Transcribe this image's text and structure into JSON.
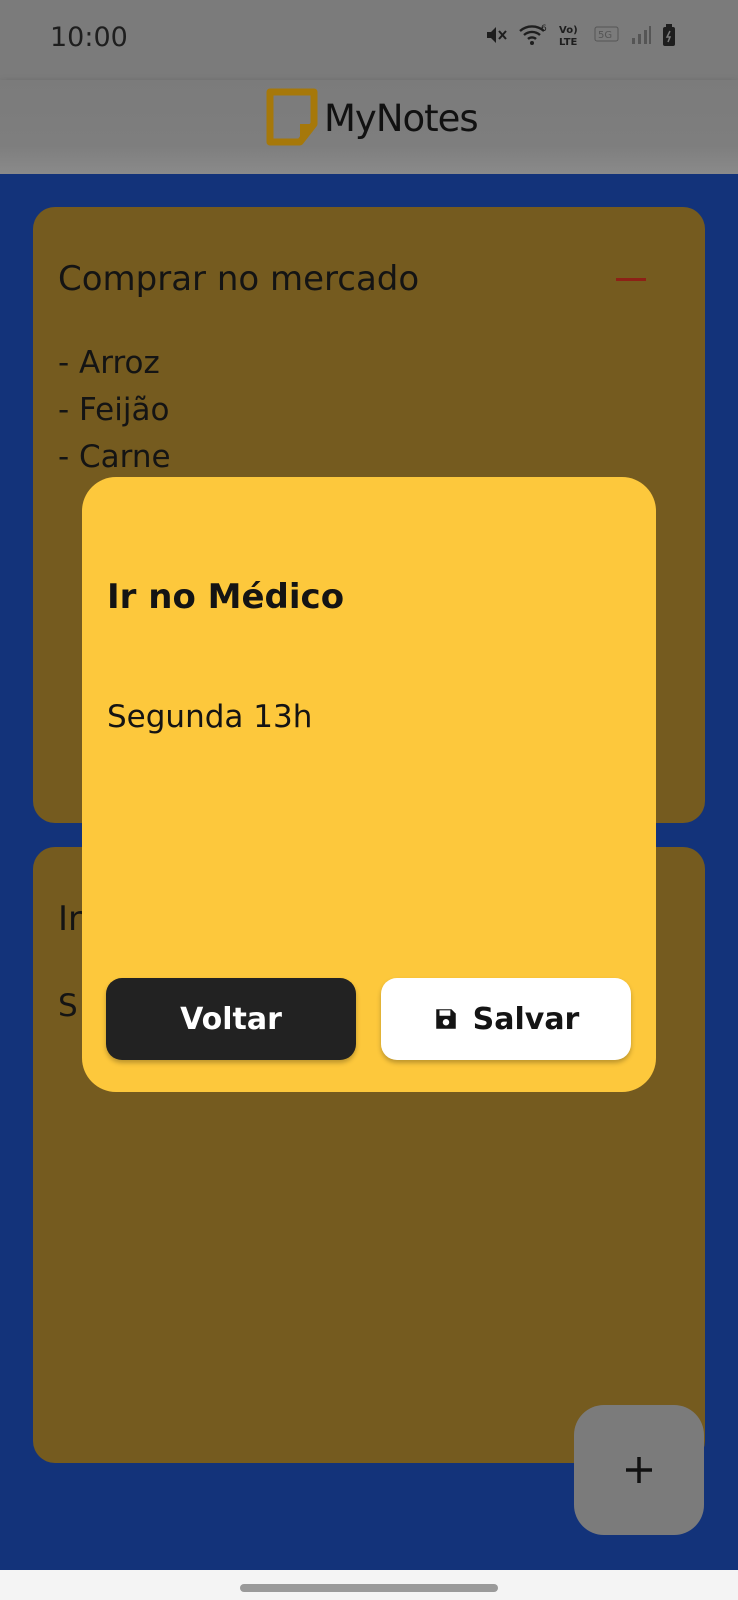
{
  "status_bar": {
    "time": "10:00",
    "icons": [
      "mute-icon",
      "wifi-icon",
      "volte-icon",
      "5g-icon",
      "signal-icon",
      "battery-icon"
    ]
  },
  "header": {
    "app_name": "MyNotes",
    "logo_icon": "note-logo-icon",
    "logo_color": "#a6780a"
  },
  "notes": [
    {
      "title": "Comprar no mercado",
      "body": "- Arroz\n- Feijão\n- Carne",
      "remove_icon": "minus-icon"
    },
    {
      "title": "Ir",
      "body": "S"
    }
  ],
  "dialog": {
    "title": "Ir no Médico",
    "body": "Segunda 13h",
    "back_label": "Voltar",
    "save_label": "Salvar",
    "save_icon": "floppy-disk-icon"
  },
  "fab": {
    "icon": "plus-icon"
  },
  "colors": {
    "background": "#13337a",
    "card_dimmed": "#755b1f",
    "dialog": "#fdc83c",
    "remove": "#8d2116"
  }
}
